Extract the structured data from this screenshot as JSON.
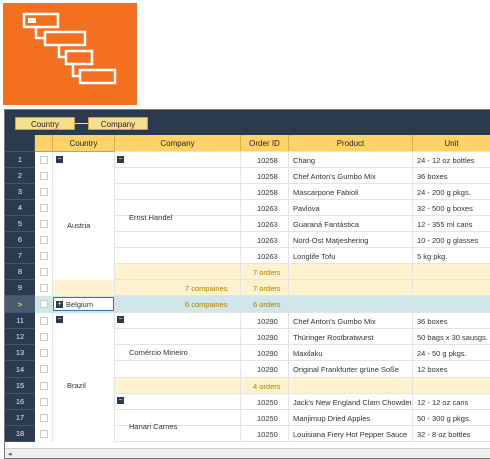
{
  "groupby": [
    "Country",
    "Company"
  ],
  "headers": [
    "Country",
    "Company",
    "Order ID",
    "Product",
    "Unit"
  ],
  "row_numbers": [
    "1",
    "2",
    "3",
    "4",
    "5",
    "6",
    "7",
    "8",
    "9",
    ">",
    "11",
    "12",
    "13",
    "14",
    "15",
    "16",
    "17",
    "18"
  ],
  "groups": {
    "austria": "Austria",
    "ernst": "Ernst Handel",
    "austria_orders": "7 orders",
    "austria_companies": "7 compaines",
    "austria_orders2": "7 orders",
    "belgium_toggle": "+",
    "belgium": "Belgium",
    "belgium_companies": "6 compaines",
    "belgium_orders": "6 orders",
    "brazil": "Brazil",
    "comercio": "Comércio Mineiro",
    "comercio_orders": "4 orders",
    "hanari": "Hanari Carnes",
    "collapse_toggle": "−"
  },
  "rows": [
    {
      "order": "10258",
      "product": "Chang",
      "unit": "24 - 12 oz bottles"
    },
    {
      "order": "10258",
      "product": "Chef Anton's Gumbo Mix",
      "unit": "36 boxes"
    },
    {
      "order": "10258",
      "product": "Mascarpone Fabioli",
      "unit": "24 - 200 g pkgs."
    },
    {
      "order": "10263",
      "product": "Pavlova",
      "unit": "32 - 500 g boxes"
    },
    {
      "order": "10263",
      "product": "Guaraná Fantástica",
      "unit": "12 - 355 ml cans"
    },
    {
      "order": "10263",
      "product": "Nord-Ost Matjeshering",
      "unit": "10 - 200 g glasses"
    },
    {
      "order": "10263",
      "product": "Longlife Tofu",
      "unit": "5 kg pkg."
    },
    {
      "order": "10290",
      "product": "Chef Anton's Gumbo Mix",
      "unit": "36 boxes"
    },
    {
      "order": "10290",
      "product": "Thüringer Rostbratwurst",
      "unit": "50 bags x 30 sausgs."
    },
    {
      "order": "10290",
      "product": "Maxilaku",
      "unit": "24 - 50 g pkgs."
    },
    {
      "order": "10290",
      "product": "Original Frankfurter grüne Soße",
      "unit": "12 boxes"
    },
    {
      "order": "10250",
      "product": "Jack's New England Clam Chowder",
      "unit": "12 - 12 oz cans"
    },
    {
      "order": "10250",
      "product": "Manjimup Dried Apples",
      "unit": "50 - 300 g pkgs."
    },
    {
      "order": "10250",
      "product": "Louisiana Fiery Hot Pepper Sauce",
      "unit": "32 - 8 oz bottles"
    }
  ],
  "colors": {
    "accent": "#f37021",
    "header": "#ffd36a",
    "dark": "#2b3a4d",
    "selected": "#cfe6ea",
    "footer": "#fff3cf"
  }
}
